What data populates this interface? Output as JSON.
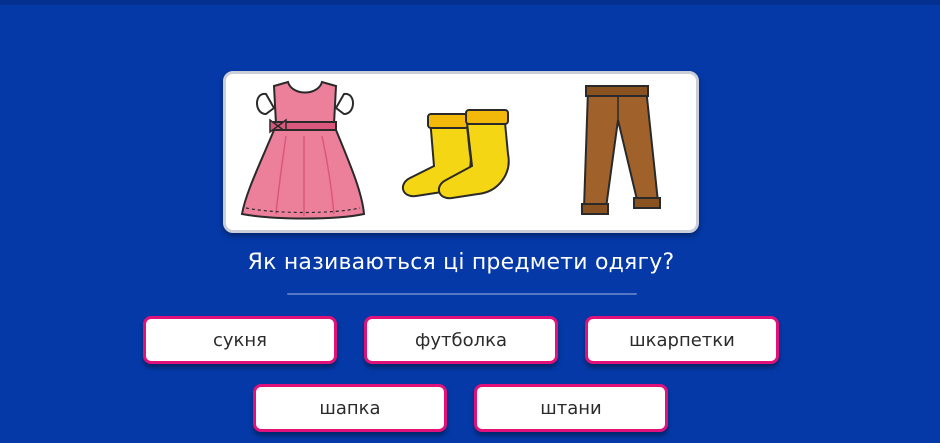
{
  "quiz": {
    "question": "Як називаються ці предмети одягу?",
    "images": [
      {
        "icon": "dress-icon",
        "color": "#ec7f9a"
      },
      {
        "icon": "socks-icon",
        "color": "#f5d614"
      },
      {
        "icon": "trousers-icon",
        "color": "#a0622a"
      }
    ],
    "options": [
      {
        "label": "сукня"
      },
      {
        "label": "футболка"
      },
      {
        "label": "шкарпетки"
      },
      {
        "label": "шапка"
      },
      {
        "label": "штани"
      }
    ]
  },
  "colors": {
    "background": "#0539a7",
    "option_border": "#e0127a",
    "text_white": "#ffffff"
  }
}
